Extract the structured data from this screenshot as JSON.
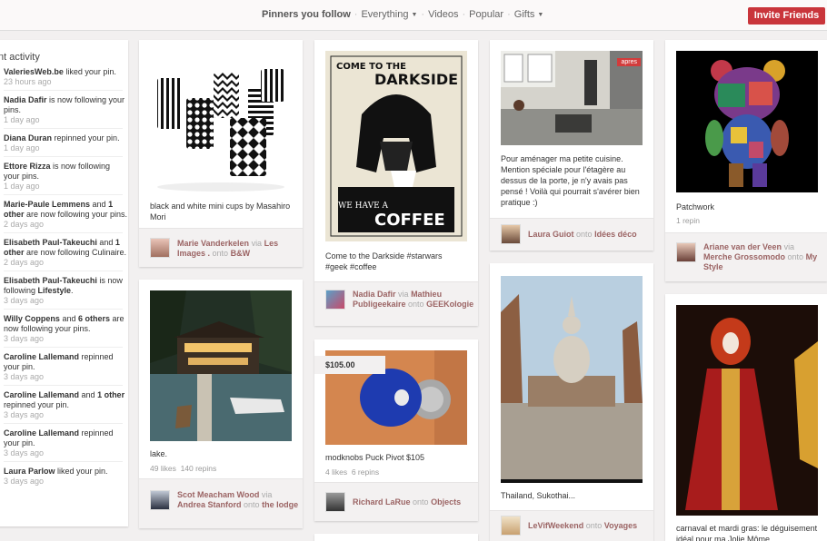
{
  "nav": {
    "pinners_you_follow": "Pinners you follow",
    "everything": "Everything",
    "videos": "Videos",
    "popular": "Popular",
    "gifts": "Gifts",
    "invite_button": "Invite Friends"
  },
  "activity": {
    "title": "nt activity",
    "items": [
      {
        "a": "ValeriesWeb.be",
        "b": " liked your pin.",
        "t": "23 hours ago"
      },
      {
        "a": "Nadia Dafir",
        "b": " is now following your pins.",
        "t": "1 day ago"
      },
      {
        "a": "Diana Duran",
        "b": " repinned your pin.",
        "t": "1 day ago"
      },
      {
        "a": "Ettore Rizza",
        "b": " is now following your pins.",
        "t": "1 day ago"
      },
      {
        "a": "Marie-Paule Lemmens",
        "b": " and ",
        "c": "1 other",
        "d": " are now following your pins.",
        "t": "2 days ago"
      },
      {
        "a": "Elisabeth Paul-Takeuchi",
        "b": " and ",
        "c": "1 other",
        "d": " are now following Culinaire.",
        "t": "2 days ago"
      },
      {
        "a": "Elisabeth Paul-Takeuchi",
        "b": " is now following ",
        "c": "Lifestyle",
        "d": ".",
        "t": "3 days ago"
      },
      {
        "a": "Willy Coppens",
        "b": " and ",
        "c": "6 others",
        "d": " are now following your pins.",
        "t": "3 days ago"
      },
      {
        "a": "Caroline Lallemand",
        "b": " repinned your pin.",
        "t": "3 days ago"
      },
      {
        "a": "Caroline Lallemand",
        "b": " and ",
        "c": "1 other",
        "d": " repinned your pin.",
        "t": "3 days ago"
      },
      {
        "a": "Caroline Lallemand",
        "b": " repinned your pin.",
        "t": "3 days ago"
      },
      {
        "a": "Laura Parlow",
        "b": " liked your pin.",
        "t": "3 days ago"
      }
    ]
  },
  "pins": {
    "cups": {
      "desc": "black and white mini cups by Masahiro Mori",
      "user": "Marie Vanderkelen",
      "via": "via",
      "board_user": "Les Images .",
      "onto": "onto",
      "board": "B&W"
    },
    "darkside": {
      "poster_top": "COME TO THE",
      "poster_main": "DARKSIDE",
      "poster_we": "WE HAVE A",
      "poster_coffee": "COFFEE",
      "desc": "Come to the Darkside #starwars #geek #coffee",
      "user": "Nadia Dafir",
      "via": "via",
      "board_user": "Mathieu Publigeekaire",
      "onto": "onto",
      "board": "GEEKologie"
    },
    "kitchen": {
      "tag": "apres",
      "desc": "Pour aménager ma petite cuisine. Mention spéciale pour l'étagère au dessus de la porte, je n'y avais pas pensé ! Voilà qui pourrait s'avérer bien pratique :)",
      "user": "Laura Guiot",
      "onto": "onto",
      "board": "Idées déco"
    },
    "bear": {
      "desc": "Patchwork",
      "stats": "1 repin",
      "user": "Ariane van der Veen",
      "via": "via",
      "board_user": "Merche Grossomodo",
      "onto": "onto",
      "board": "My Style"
    },
    "lake": {
      "desc": "lake.",
      "likes": "49 likes",
      "repins": "140 repins",
      "user": "Scot Meacham Wood",
      "via": "via",
      "board_user": "Andrea Stanford",
      "onto": "onto",
      "board": "the lodge"
    },
    "puck": {
      "price": "$105.00",
      "desc": "modknobs Puck Pivot $105",
      "likes": "4 likes",
      "repins": "6 repins",
      "user": "Richard LaRue",
      "onto": "onto",
      "board": "Objects"
    },
    "thailand": {
      "desc": "Thailand, Sukothai...",
      "user": "LeVifWeekend",
      "onto": "onto",
      "board": "Voyages"
    },
    "carnaval": {
      "desc": "carnaval et mardi gras: le déguisement idéal pour ma Jolie Môme"
    }
  }
}
